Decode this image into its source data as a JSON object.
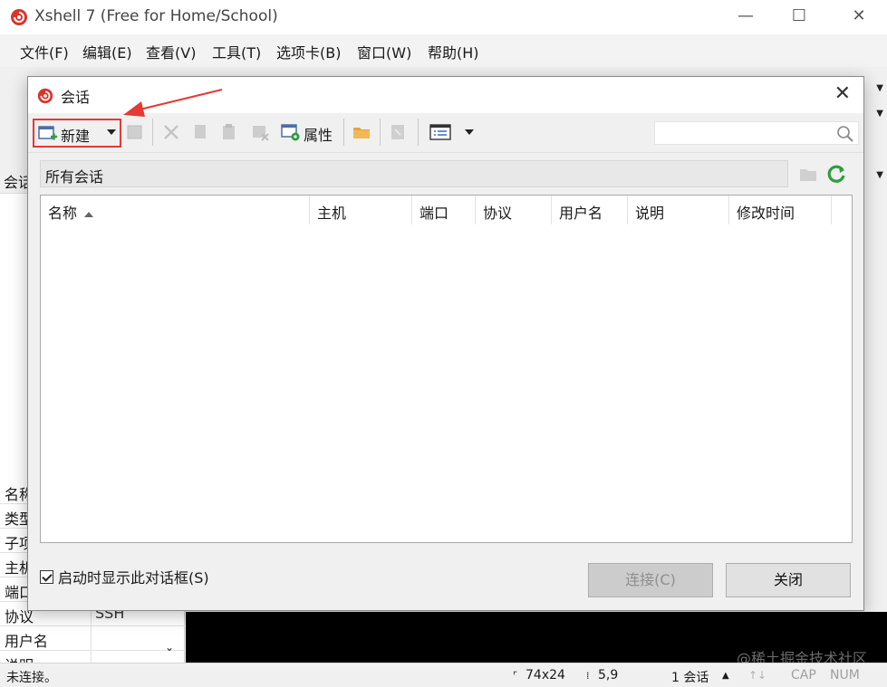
{
  "app": {
    "title": "Xshell 7 (Free for Home/School)",
    "window_controls": [
      "—",
      "☐",
      "✕"
    ]
  },
  "menu": [
    "文件(F)",
    "编辑(E)",
    "查看(V)",
    "工具(T)",
    "选项卡(B)",
    "窗口(W)",
    "帮助(H)"
  ],
  "left_pane": {
    "header": "会话",
    "properties": [
      {
        "key": "名称",
        "value": ""
      },
      {
        "key": "类型",
        "value": ""
      },
      {
        "key": "子项",
        "value": ""
      },
      {
        "key": "主机",
        "value": ""
      },
      {
        "key": "端口",
        "value": ""
      },
      {
        "key": "协议",
        "value": "SSH"
      },
      {
        "key": "用户名",
        "value": ""
      },
      {
        "key": "说明",
        "value": ""
      }
    ]
  },
  "dialog": {
    "title": "会话",
    "close": "✕",
    "toolbar": {
      "new_label": "新建",
      "properties_label": "属性",
      "search_placeholder": ""
    },
    "path": "所有会话",
    "columns": [
      "名称",
      "主机",
      "端口",
      "协议",
      "用户名",
      "说明",
      "修改时间"
    ],
    "sessions": [],
    "show_on_startup": {
      "label": "启动时显示此对话框(S)",
      "checked": true
    },
    "connect_label": "连接(C)",
    "close_label": "关闭"
  },
  "statusbar": {
    "status": "未连接。",
    "size": "74x24",
    "position": "5,9",
    "sessions": "1 会话",
    "cap": "CAP",
    "num": "NUM"
  },
  "watermark": "@稀土掘金技术社区",
  "colors": {
    "highlight": "#e53935",
    "accent_green": "#2e9d3d",
    "logo": "#d9352c"
  }
}
